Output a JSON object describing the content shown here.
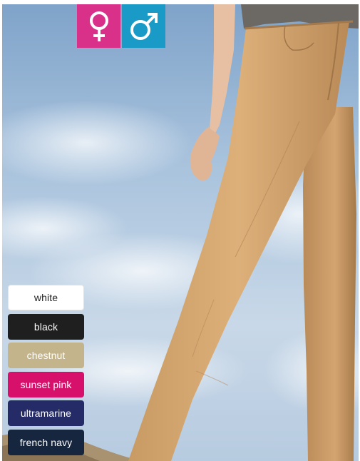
{
  "gender_buttons": [
    {
      "icon": "female-symbol-icon",
      "color": "#d9318a"
    },
    {
      "icon": "male-symbol-icon",
      "color": "#1a9ac6"
    }
  ],
  "colors": [
    {
      "label": "white",
      "bg": "#ffffff",
      "fg": "#222222"
    },
    {
      "label": "black",
      "bg": "#1f1f1f",
      "fg": "#ffffff"
    },
    {
      "label": "chestnut",
      "bg": "#c4b48b",
      "fg": "#ffffff"
    },
    {
      "label": "sunset pink",
      "bg": "#d6106b",
      "fg": "#ffffff"
    },
    {
      "label": "ultramarine",
      "bg": "#242b66",
      "fg": "#ffffff"
    },
    {
      "label": "french navy",
      "bg": "#17263f",
      "fg": "#ffffff"
    }
  ]
}
